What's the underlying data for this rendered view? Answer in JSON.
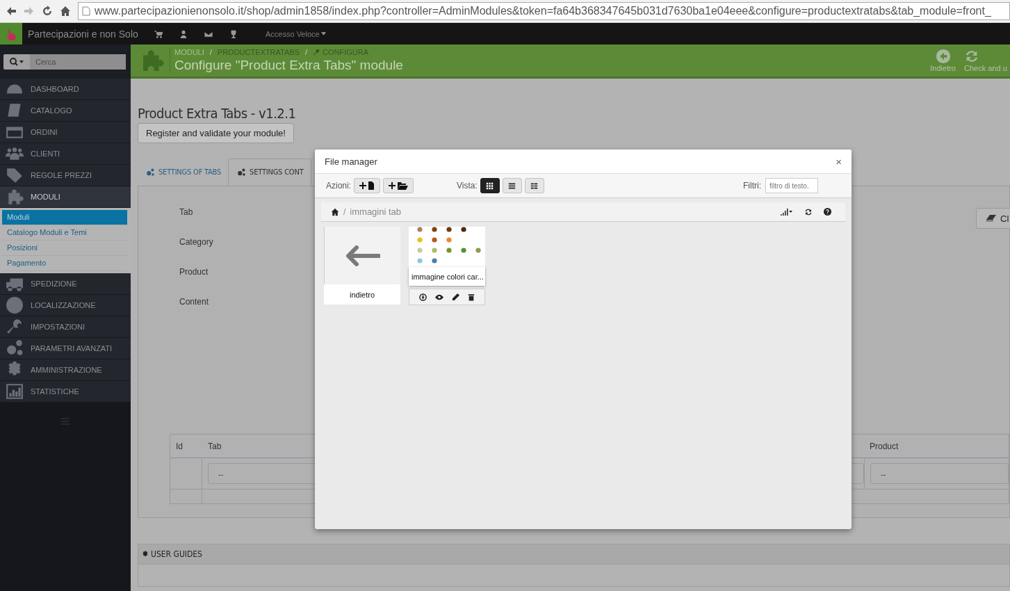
{
  "browser": {
    "url": "www.partecipazionienonsolo.it/shop/admin1858/index.php?controller=AdminModules&token=fa64b368347645b031d7630ba1e04eee&configure=productextratabs&tab_module=front_"
  },
  "header": {
    "shop_name": "Partecipazioni e non Solo",
    "quick_access": "Accesso Veloce"
  },
  "sidebar": {
    "search_placeholder": "Cerca",
    "items": [
      {
        "label": "DASHBOARD",
        "selected": false
      },
      {
        "label": "CATALOGO",
        "selected": false
      },
      {
        "label": "ORDINI",
        "selected": false
      },
      {
        "label": "CLIENTI",
        "selected": false
      },
      {
        "label": "REGOLE PREZZI",
        "selected": false
      },
      {
        "label": "MODULI",
        "selected": true,
        "children": [
          {
            "label": "Moduli",
            "selected": true
          },
          {
            "label": "Catalogo Moduli e Temi",
            "selected": false
          },
          {
            "label": "Posizioni",
            "selected": false
          },
          {
            "label": "Pagamento",
            "selected": false
          }
        ]
      },
      {
        "label": "SPEDIZIONE",
        "selected": false
      },
      {
        "label": "LOCALIZZAZIONE",
        "selected": false
      },
      {
        "label": "IMPOSTAZIONI",
        "selected": false
      },
      {
        "label": "PARAMETRI AVANZATI",
        "selected": false
      },
      {
        "label": "AMMINISTRAZIONE",
        "selected": false
      },
      {
        "label": "STATISTICHE",
        "selected": false
      }
    ]
  },
  "toolbar": {
    "breadcrumb": [
      "MODULI",
      "PRODUCTEXTRATABS",
      "CONFIGURA"
    ],
    "breadcrumb_separator": "/",
    "title": "Configure \"Product Extra Tabs\" module",
    "buttons": [
      "Indietro",
      "Check and u"
    ]
  },
  "page": {
    "title": "Product Extra Tabs - v1.2.1",
    "register_button": "Register and validate your module!",
    "tabs": [
      {
        "label": "SETTINGS OF TABS",
        "selected": false
      },
      {
        "label": "SETTINGS CONT",
        "selected": true
      }
    ],
    "form_labels": [
      "Tab",
      "Category",
      "Product",
      "Content"
    ],
    "clear_button": "Cl",
    "table": {
      "columns": [
        "Id",
        "Tab",
        "Product"
      ],
      "filters": [
        "--",
        "--"
      ]
    }
  },
  "user_guides": "USER GUIDES",
  "file_manager": {
    "title": "File manager",
    "close": "×",
    "actions_label": "Azioni:",
    "view_label": "Vista:",
    "views": [
      {
        "kind": "grid",
        "selected": true
      },
      {
        "kind": "list",
        "selected": false
      },
      {
        "kind": "columns",
        "selected": false
      }
    ],
    "filter_label": "Filtri:",
    "filter_placeholder": "filtro di testo.",
    "path_separator": "/",
    "path": "immagini tab",
    "items": [
      {
        "kind": "back",
        "name": "indietro"
      },
      {
        "name": "immagine colori car..."
      }
    ]
  }
}
